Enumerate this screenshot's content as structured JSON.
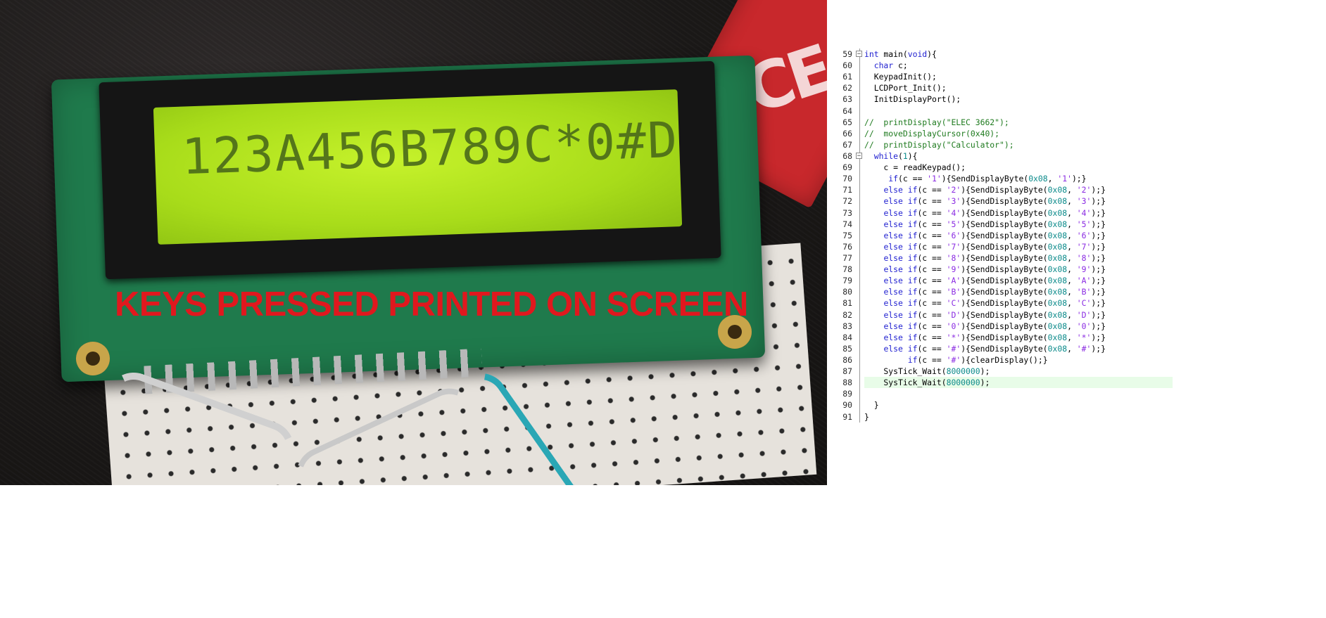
{
  "photo": {
    "caption": "KEYS PRESSED PRINTED ON SCREEN",
    "lcd_text": "123A456B789C*0#D",
    "ce_mark": "CE"
  },
  "editor": {
    "current_line": 88,
    "fold_markers": [
      59,
      68
    ],
    "lines": [
      {
        "n": "59",
        "segs": [
          [
            "kw",
            "int"
          ],
          [
            "t",
            " main("
          ],
          [
            "kw",
            "void"
          ],
          [
            "t",
            "){"
          ]
        ]
      },
      {
        "n": "60",
        "segs": [
          [
            "t",
            "  "
          ],
          [
            "kw",
            "char"
          ],
          [
            "t",
            " c;"
          ]
        ]
      },
      {
        "n": "61",
        "segs": [
          [
            "t",
            "  KeypadInit();"
          ]
        ]
      },
      {
        "n": "62",
        "segs": [
          [
            "t",
            "  LCDPort_Init();"
          ]
        ]
      },
      {
        "n": "63",
        "segs": [
          [
            "t",
            "  InitDisplayPort();"
          ]
        ]
      },
      {
        "n": "64",
        "segs": []
      },
      {
        "n": "65",
        "segs": [
          [
            "com",
            "//  printDisplay(\"ELEC 3662\");"
          ]
        ]
      },
      {
        "n": "66",
        "segs": [
          [
            "com",
            "//  moveDisplayCursor(0x40);"
          ]
        ]
      },
      {
        "n": "67",
        "segs": [
          [
            "com",
            "//  printDisplay(\"Calculator\");"
          ]
        ]
      },
      {
        "n": "68",
        "segs": [
          [
            "t",
            "  "
          ],
          [
            "kw",
            "while"
          ],
          [
            "t",
            "("
          ],
          [
            "num",
            "1"
          ],
          [
            "t",
            "){"
          ]
        ]
      },
      {
        "n": "69",
        "segs": [
          [
            "t",
            "    c = readKeypad();"
          ]
        ]
      },
      {
        "n": "70",
        "segs": [
          [
            "t",
            "     "
          ],
          [
            "kw",
            "if"
          ],
          [
            "t",
            "(c == "
          ],
          [
            "str",
            "'1'"
          ],
          [
            "t",
            "){SendDisplayByte("
          ],
          [
            "num",
            "0x08"
          ],
          [
            "t",
            ", "
          ],
          [
            "str",
            "'1'"
          ],
          [
            "t",
            ");}"
          ]
        ]
      },
      {
        "n": "71",
        "segs": [
          [
            "t",
            "    "
          ],
          [
            "kw",
            "else if"
          ],
          [
            "t",
            "(c == "
          ],
          [
            "str",
            "'2'"
          ],
          [
            "t",
            "){SendDisplayByte("
          ],
          [
            "num",
            "0x08"
          ],
          [
            "t",
            ", "
          ],
          [
            "str",
            "'2'"
          ],
          [
            "t",
            ");}"
          ]
        ]
      },
      {
        "n": "72",
        "segs": [
          [
            "t",
            "    "
          ],
          [
            "kw",
            "else if"
          ],
          [
            "t",
            "(c == "
          ],
          [
            "str",
            "'3'"
          ],
          [
            "t",
            "){SendDisplayByte("
          ],
          [
            "num",
            "0x08"
          ],
          [
            "t",
            ", "
          ],
          [
            "str",
            "'3'"
          ],
          [
            "t",
            ");}"
          ]
        ]
      },
      {
        "n": "73",
        "segs": [
          [
            "t",
            "    "
          ],
          [
            "kw",
            "else if"
          ],
          [
            "t",
            "(c == "
          ],
          [
            "str",
            "'4'"
          ],
          [
            "t",
            "){SendDisplayByte("
          ],
          [
            "num",
            "0x08"
          ],
          [
            "t",
            ", "
          ],
          [
            "str",
            "'4'"
          ],
          [
            "t",
            ");}"
          ]
        ]
      },
      {
        "n": "74",
        "segs": [
          [
            "t",
            "    "
          ],
          [
            "kw",
            "else if"
          ],
          [
            "t",
            "(c == "
          ],
          [
            "str",
            "'5'"
          ],
          [
            "t",
            "){SendDisplayByte("
          ],
          [
            "num",
            "0x08"
          ],
          [
            "t",
            ", "
          ],
          [
            "str",
            "'5'"
          ],
          [
            "t",
            ");}"
          ]
        ]
      },
      {
        "n": "75",
        "segs": [
          [
            "t",
            "    "
          ],
          [
            "kw",
            "else if"
          ],
          [
            "t",
            "(c == "
          ],
          [
            "str",
            "'6'"
          ],
          [
            "t",
            "){SendDisplayByte("
          ],
          [
            "num",
            "0x08"
          ],
          [
            "t",
            ", "
          ],
          [
            "str",
            "'6'"
          ],
          [
            "t",
            ");}"
          ]
        ]
      },
      {
        "n": "76",
        "segs": [
          [
            "t",
            "    "
          ],
          [
            "kw",
            "else if"
          ],
          [
            "t",
            "(c == "
          ],
          [
            "str",
            "'7'"
          ],
          [
            "t",
            "){SendDisplayByte("
          ],
          [
            "num",
            "0x08"
          ],
          [
            "t",
            ", "
          ],
          [
            "str",
            "'7'"
          ],
          [
            "t",
            ");}"
          ]
        ]
      },
      {
        "n": "77",
        "segs": [
          [
            "t",
            "    "
          ],
          [
            "kw",
            "else if"
          ],
          [
            "t",
            "(c == "
          ],
          [
            "str",
            "'8'"
          ],
          [
            "t",
            "){SendDisplayByte("
          ],
          [
            "num",
            "0x08"
          ],
          [
            "t",
            ", "
          ],
          [
            "str",
            "'8'"
          ],
          [
            "t",
            ");}"
          ]
        ]
      },
      {
        "n": "78",
        "segs": [
          [
            "t",
            "    "
          ],
          [
            "kw",
            "else if"
          ],
          [
            "t",
            "(c == "
          ],
          [
            "str",
            "'9'"
          ],
          [
            "t",
            "){SendDisplayByte("
          ],
          [
            "num",
            "0x08"
          ],
          [
            "t",
            ", "
          ],
          [
            "str",
            "'9'"
          ],
          [
            "t",
            ");}"
          ]
        ]
      },
      {
        "n": "79",
        "segs": [
          [
            "t",
            "    "
          ],
          [
            "kw",
            "else if"
          ],
          [
            "t",
            "(c == "
          ],
          [
            "str",
            "'A'"
          ],
          [
            "t",
            "){SendDisplayByte("
          ],
          [
            "num",
            "0x08"
          ],
          [
            "t",
            ", "
          ],
          [
            "str",
            "'A'"
          ],
          [
            "t",
            ");}"
          ]
        ]
      },
      {
        "n": "80",
        "segs": [
          [
            "t",
            "    "
          ],
          [
            "kw",
            "else if"
          ],
          [
            "t",
            "(c == "
          ],
          [
            "str",
            "'B'"
          ],
          [
            "t",
            "){SendDisplayByte("
          ],
          [
            "num",
            "0x08"
          ],
          [
            "t",
            ", "
          ],
          [
            "str",
            "'B'"
          ],
          [
            "t",
            ");}"
          ]
        ]
      },
      {
        "n": "81",
        "segs": [
          [
            "t",
            "    "
          ],
          [
            "kw",
            "else if"
          ],
          [
            "t",
            "(c == "
          ],
          [
            "str",
            "'C'"
          ],
          [
            "t",
            "){SendDisplayByte("
          ],
          [
            "num",
            "0x08"
          ],
          [
            "t",
            ", "
          ],
          [
            "str",
            "'C'"
          ],
          [
            "t",
            ");}"
          ]
        ]
      },
      {
        "n": "82",
        "segs": [
          [
            "t",
            "    "
          ],
          [
            "kw",
            "else if"
          ],
          [
            "t",
            "(c == "
          ],
          [
            "str",
            "'D'"
          ],
          [
            "t",
            "){SendDisplayByte("
          ],
          [
            "num",
            "0x08"
          ],
          [
            "t",
            ", "
          ],
          [
            "str",
            "'D'"
          ],
          [
            "t",
            ");}"
          ]
        ]
      },
      {
        "n": "83",
        "segs": [
          [
            "t",
            "    "
          ],
          [
            "kw",
            "else if"
          ],
          [
            "t",
            "(c == "
          ],
          [
            "str",
            "'0'"
          ],
          [
            "t",
            "){SendDisplayByte("
          ],
          [
            "num",
            "0x08"
          ],
          [
            "t",
            ", "
          ],
          [
            "str",
            "'0'"
          ],
          [
            "t",
            ");}"
          ]
        ]
      },
      {
        "n": "84",
        "segs": [
          [
            "t",
            "    "
          ],
          [
            "kw",
            "else if"
          ],
          [
            "t",
            "(c == "
          ],
          [
            "str",
            "'*'"
          ],
          [
            "t",
            "){SendDisplayByte("
          ],
          [
            "num",
            "0x08"
          ],
          [
            "t",
            ", "
          ],
          [
            "str",
            "'*'"
          ],
          [
            "t",
            ");}"
          ]
        ]
      },
      {
        "n": "85",
        "segs": [
          [
            "t",
            "    "
          ],
          [
            "kw",
            "else if"
          ],
          [
            "t",
            "(c == "
          ],
          [
            "str",
            "'#'"
          ],
          [
            "t",
            "){SendDisplayByte("
          ],
          [
            "num",
            "0x08"
          ],
          [
            "t",
            ", "
          ],
          [
            "str",
            "'#'"
          ],
          [
            "t",
            ");}"
          ]
        ]
      },
      {
        "n": "86",
        "segs": [
          [
            "t",
            "         "
          ],
          [
            "kw",
            "if"
          ],
          [
            "t",
            "(c == "
          ],
          [
            "str",
            "'#'"
          ],
          [
            "t",
            "){clearDisplay();}"
          ]
        ]
      },
      {
        "n": "87",
        "segs": [
          [
            "t",
            "    SysTick_Wait("
          ],
          [
            "num",
            "8000000"
          ],
          [
            "t",
            ");"
          ]
        ]
      },
      {
        "n": "88",
        "segs": [
          [
            "t",
            "    SysTick_Wait("
          ],
          [
            "num",
            "8000000"
          ],
          [
            "t",
            ");"
          ]
        ]
      },
      {
        "n": "89",
        "segs": []
      },
      {
        "n": "90",
        "segs": [
          [
            "t",
            "  }"
          ]
        ]
      },
      {
        "n": "91",
        "segs": [
          [
            "t",
            "}"
          ]
        ]
      }
    ]
  },
  "colors": {
    "caption_red": "#e0181e",
    "keyword_blue": "#1f1fd0",
    "string_purple": "#8a2be2",
    "number_teal": "#0a8a8a",
    "comment_green": "#1e7a1e",
    "current_line_bg": "#e8fce8",
    "lcd_green": "#b4e622"
  }
}
